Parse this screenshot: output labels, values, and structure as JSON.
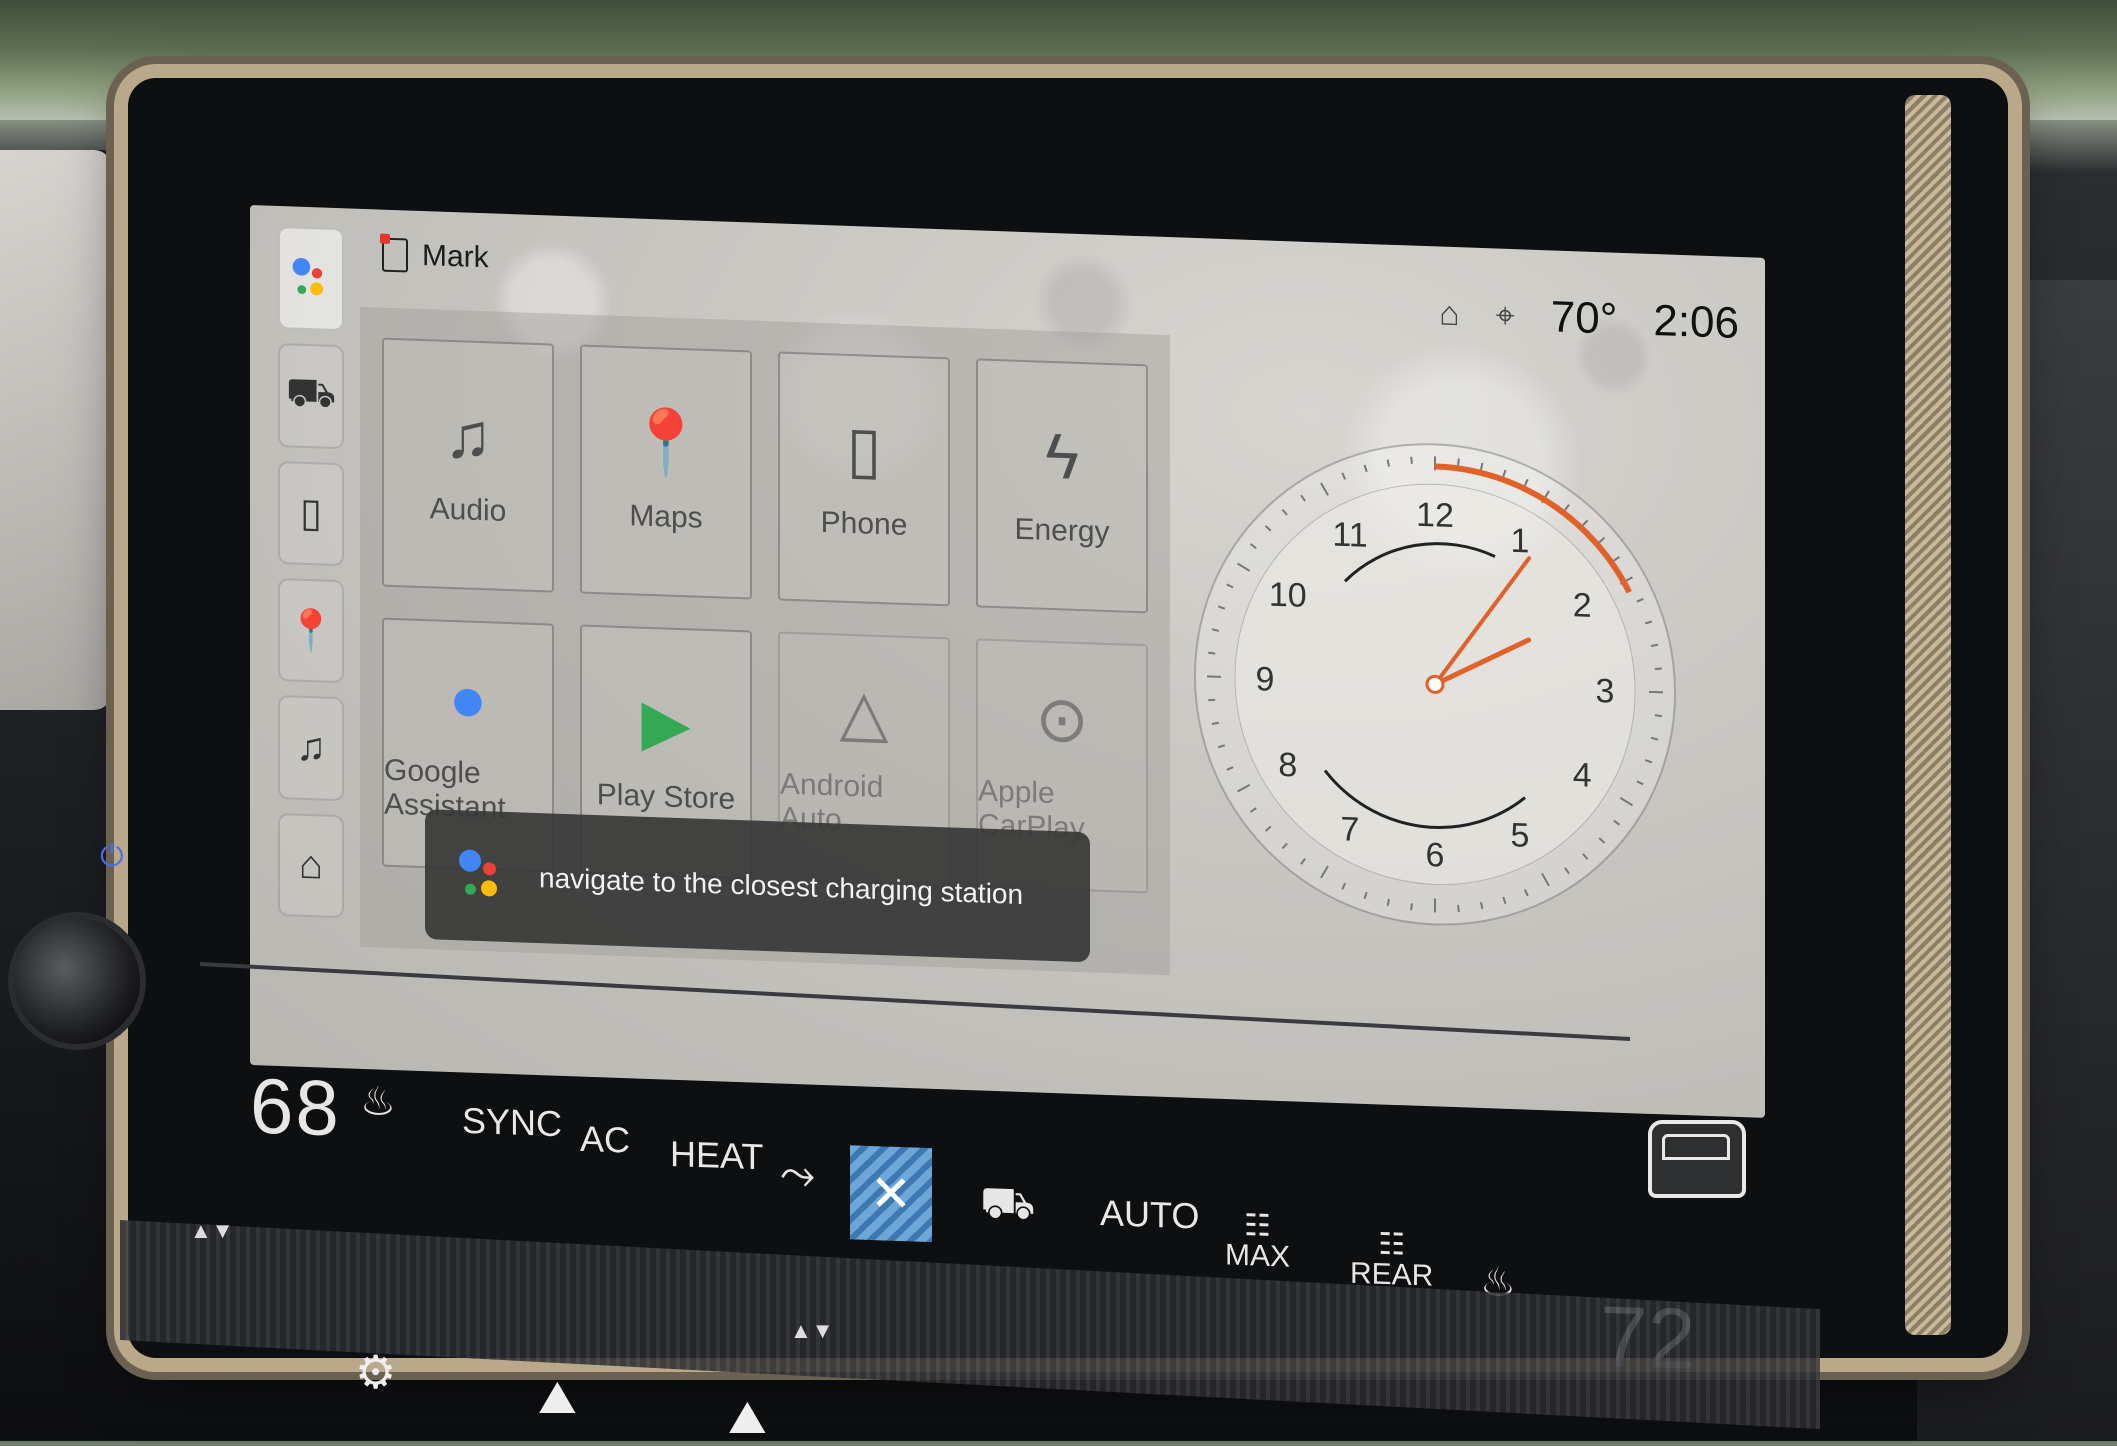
{
  "status_bar": {
    "user_name": "Mark",
    "temperature": "70°",
    "time": "2:06"
  },
  "rail": {
    "items": [
      {
        "name": "google-assistant",
        "icon": "assistant-icon"
      },
      {
        "name": "vehicle",
        "icon": "truck-icon"
      },
      {
        "name": "phone",
        "icon": "phone-icon"
      },
      {
        "name": "maps",
        "icon": "map-pin-icon"
      },
      {
        "name": "audio",
        "icon": "music-note-icon"
      },
      {
        "name": "home",
        "icon": "home-icon"
      }
    ]
  },
  "apps": {
    "tiles": [
      {
        "label": "Audio",
        "glyph": "♫"
      },
      {
        "label": "Maps",
        "glyph": "📍"
      },
      {
        "label": "Phone",
        "glyph": "▯"
      },
      {
        "label": "Energy",
        "glyph": "ϟ"
      },
      {
        "label": "Google Assistant",
        "glyph": "●"
      },
      {
        "label": "Play Store",
        "glyph": "▶"
      },
      {
        "label": "Android Auto",
        "glyph": "△"
      },
      {
        "label": "Apple CarPlay",
        "glyph": "⊙"
      }
    ]
  },
  "assistant": {
    "query": "navigate to the closest charging station"
  },
  "clock": {
    "hour_labels": [
      "12",
      "1",
      "2",
      "3",
      "4",
      "5",
      "6",
      "7",
      "8",
      "9",
      "10",
      "11"
    ],
    "hour": 2,
    "minute": 6
  },
  "climate": {
    "left_temp": "68",
    "right_temp": "72",
    "sync_label": "SYNC",
    "ac_label": "AC",
    "heat_label": "HEAT",
    "auto_label": "AUTO",
    "max_label": "MAX",
    "rear_label": "REAR"
  },
  "colors": {
    "accent_orange": "#e0622a",
    "climate_selected": "#4f8cc9"
  }
}
